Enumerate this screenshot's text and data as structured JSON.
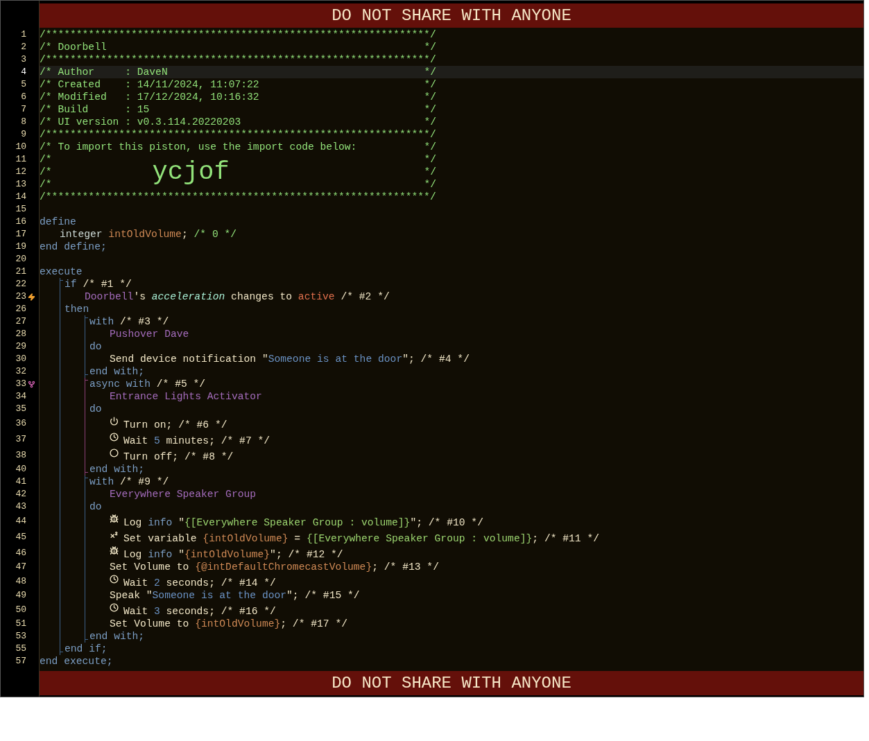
{
  "header_banner": "DO NOT SHARE WITH ANYONE",
  "code": [
    {
      "kind": "line",
      "n": "1",
      "selected": false,
      "tokens": [
        {
          "kind": "comment",
          "text": "/***************************************************************/"
        }
      ]
    },
    {
      "kind": "line",
      "n": "2",
      "selected": false,
      "tokens": [
        {
          "kind": "comment",
          "text": "/* Doorbell"
        },
        {
          "kind": "comment-end",
          "text": "*/"
        }
      ]
    },
    {
      "kind": "line",
      "n": "3",
      "selected": false,
      "tokens": [
        {
          "kind": "comment",
          "text": "/***************************************************************/"
        }
      ]
    },
    {
      "kind": "line",
      "n": "4",
      "selected": true,
      "tokens": [
        {
          "kind": "comment",
          "text": "/* Author     : DaveN"
        },
        {
          "kind": "comment-end",
          "text": "*/"
        }
      ]
    },
    {
      "kind": "line",
      "n": "5",
      "selected": false,
      "tokens": [
        {
          "kind": "comment",
          "text": "/* Created    : 14/11/2024, 11:07:22"
        },
        {
          "kind": "comment-end",
          "text": "*/"
        }
      ]
    },
    {
      "kind": "line",
      "n": "6",
      "selected": false,
      "tokens": [
        {
          "kind": "comment",
          "text": "/* Modified   : 17/12/2024, 10:16:32"
        },
        {
          "kind": "comment-end",
          "text": "*/"
        }
      ]
    },
    {
      "kind": "line",
      "n": "7",
      "selected": false,
      "tokens": [
        {
          "kind": "comment",
          "text": "/* Build      : 15"
        },
        {
          "kind": "comment-end",
          "text": "*/"
        }
      ]
    },
    {
      "kind": "line",
      "n": "8",
      "selected": false,
      "tokens": [
        {
          "kind": "comment",
          "text": "/* UI version : v0.3.114.20220203"
        },
        {
          "kind": "comment-end",
          "text": "*/"
        }
      ]
    },
    {
      "kind": "line",
      "n": "9",
      "selected": false,
      "tokens": [
        {
          "kind": "comment",
          "text": "/***************************************************************/"
        }
      ]
    },
    {
      "kind": "line",
      "n": "10",
      "selected": false,
      "tokens": [
        {
          "kind": "comment",
          "text": "/* To import this piston, use the import code below:"
        },
        {
          "kind": "comment-end",
          "text": "*/"
        }
      ]
    },
    {
      "kind": "line",
      "n": "11",
      "selected": false,
      "tokens": [
        {
          "kind": "comment",
          "text": "/*"
        },
        {
          "kind": "comment-end",
          "text": "*/"
        }
      ]
    },
    {
      "kind": "line",
      "n": "12",
      "selected": false,
      "tokens": [
        {
          "kind": "comment",
          "text": "/*"
        },
        {
          "kind": "big",
          "text": "ycjof"
        },
        {
          "kind": "comment-end",
          "text": "*/"
        }
      ]
    },
    {
      "kind": "line",
      "n": "13",
      "selected": false,
      "tokens": [
        {
          "kind": "comment",
          "text": "/*"
        },
        {
          "kind": "comment-end",
          "text": "*/"
        }
      ]
    },
    {
      "kind": "line",
      "n": "14",
      "selected": false,
      "tokens": [
        {
          "kind": "comment",
          "text": "/***************************************************************/"
        }
      ]
    },
    {
      "kind": "line",
      "n": "15",
      "selected": false
    },
    {
      "kind": "line",
      "n": "16",
      "selected": false,
      "tokens": [
        {
          "kind": "keyword",
          "text": "define"
        }
      ],
      "children": [
        {
          "kind": "line",
          "n": "17",
          "selected": false,
          "tokens": [
            {
              "kind": "type",
              "text": "integer"
            },
            {
              "kind": "variable",
              "text": "intOldVolume"
            },
            {
              "kind": "plain",
              "text": "; "
            },
            {
              "kind": "comment",
              "text": "/* 0 */"
            }
          ]
        }
      ]
    },
    {
      "kind": "line",
      "n": "19",
      "selected": false,
      "tokens": [
        {
          "kind": "keyword",
          "text": "end define;"
        }
      ]
    },
    {
      "kind": "line",
      "n": "20",
      "selected": false
    },
    {
      "kind": "line",
      "n": "21",
      "selected": false,
      "tokens": [
        {
          "kind": "keyword",
          "text": "execute"
        }
      ],
      "children": [
        {
          "kind": "block",
          "color": "#3d6189",
          "children": [
            {
              "kind": "line",
              "n": "22",
              "selected": false,
              "tokens": [
                {
                  "kind": "keyword",
                  "text": "if"
                },
                {
                  "kind": "plain",
                  "text": " /* #1 */"
                }
              ],
              "children": [
                {
                  "kind": "trigger-line",
                  "n": "23",
                  "selected": false,
                  "tokens": [
                    {
                      "kind": "device",
                      "text": "Doorbell"
                    },
                    {
                      "kind": "plain",
                      "text": "'s "
                    },
                    {
                      "kind": "attribute",
                      "text": "acceleration"
                    },
                    {
                      "kind": "plain",
                      "text": " changes to "
                    },
                    {
                      "kind": "value",
                      "text": "active"
                    },
                    {
                      "kind": "plain",
                      "text": " /* #2 */"
                    }
                  ]
                }
              ]
            },
            {
              "kind": "line",
              "n": "26",
              "selected": false,
              "tokens": [
                {
                  "kind": "keyword",
                  "text": "then"
                }
              ],
              "children": [
                {
                  "kind": "block",
                  "color": "#3d6189",
                  "children": [
                    {
                      "kind": "line",
                      "n": "27",
                      "selected": false,
                      "tokens": [
                        {
                          "kind": "keyword",
                          "text": "with"
                        },
                        {
                          "kind": "plain",
                          "text": " /* #3 */"
                        }
                      ],
                      "children": [
                        {
                          "kind": "line",
                          "n": "28",
                          "selected": false,
                          "tokens": [
                            {
                              "kind": "device",
                              "text": "Pushover Dave"
                            }
                          ]
                        }
                      ]
                    },
                    {
                      "kind": "line",
                      "n": "29",
                      "selected": false,
                      "tokens": [
                        {
                          "kind": "keyword",
                          "text": "do"
                        }
                      ],
                      "children": [
                        {
                          "kind": "line",
                          "n": "30",
                          "selected": false,
                          "tokens": [
                            {
                              "kind": "plain",
                              "text": "Send device notification \""
                            },
                            {
                              "kind": "string",
                              "text": "Someone is at the door"
                            },
                            {
                              "kind": "plain",
                              "text": "\"; /* #4 */"
                            }
                          ]
                        }
                      ]
                    },
                    {
                      "kind": "line",
                      "n": "32",
                      "selected": false,
                      "tokens": [
                        {
                          "kind": "keyword",
                          "text": "end with;"
                        }
                      ]
                    }
                  ]
                },
                {
                  "kind": "block",
                  "color": "#8c3f78",
                  "children": [
                    {
                      "kind": "async-line",
                      "n": "33",
                      "selected": false,
                      "tokens": [
                        {
                          "kind": "keyword",
                          "text": "async with"
                        },
                        {
                          "kind": "plain",
                          "text": " /* #5 */"
                        }
                      ],
                      "children": [
                        {
                          "kind": "line",
                          "n": "34",
                          "selected": false,
                          "tokens": [
                            {
                              "kind": "device",
                              "text": "Entrance Lights Activator"
                            }
                          ]
                        }
                      ]
                    },
                    {
                      "kind": "line",
                      "n": "35",
                      "selected": false,
                      "tokens": [
                        {
                          "kind": "keyword",
                          "text": "do"
                        }
                      ],
                      "children": [
                        {
                          "kind": "switch-on-line",
                          "n": "36",
                          "selected": false,
                          "tokens": [
                            {
                              "kind": "plain",
                              "text": "Turn on; /* #6 */"
                            }
                          ]
                        },
                        {
                          "kind": "wait-line",
                          "n": "37",
                          "selected": false,
                          "tokens": [
                            {
                              "kind": "plain",
                              "text": "Wait "
                            },
                            {
                              "kind": "number",
                              "text": "5"
                            },
                            {
                              "kind": "plain",
                              "text": " minutes; /* #7 */"
                            }
                          ]
                        },
                        {
                          "kind": "switch-off-line",
                          "n": "38",
                          "selected": false,
                          "tokens": [
                            {
                              "kind": "plain",
                              "text": "Turn off; /* #8 */"
                            }
                          ]
                        }
                      ]
                    },
                    {
                      "kind": "line",
                      "n": "40",
                      "selected": false,
                      "tokens": [
                        {
                          "kind": "keyword",
                          "text": "end with;"
                        }
                      ]
                    }
                  ]
                },
                {
                  "kind": "block",
                  "color": "#3d6189",
                  "children": [
                    {
                      "kind": "line",
                      "n": "41",
                      "selected": false,
                      "tokens": [
                        {
                          "kind": "keyword",
                          "text": "with"
                        },
                        {
                          "kind": "plain",
                          "text": " /* #9 */"
                        }
                      ],
                      "children": [
                        {
                          "kind": "line",
                          "n": "42",
                          "selected": false,
                          "tokens": [
                            {
                              "kind": "device",
                              "text": "Everywhere Speaker Group"
                            }
                          ]
                        }
                      ]
                    },
                    {
                      "kind": "line",
                      "n": "43",
                      "selected": false,
                      "tokens": [
                        {
                          "kind": "keyword",
                          "text": "do"
                        }
                      ],
                      "children": [
                        {
                          "kind": "log-line",
                          "n": "44",
                          "selected": false,
                          "tokens": [
                            {
                              "kind": "plain",
                              "text": "Log "
                            },
                            {
                              "kind": "keyword",
                              "text": "info"
                            },
                            {
                              "kind": "plain",
                              "text": " \""
                            },
                            {
                              "kind": "expression",
                              "text": "{[Everywhere Speaker Group : volume]}"
                            },
                            {
                              "kind": "plain",
                              "text": "\"; /* #10 */"
                            }
                          ]
                        },
                        {
                          "kind": "set-variable-line",
                          "n": "45",
                          "selected": false,
                          "tokens": [
                            {
                              "kind": "plain",
                              "text": "Set variable "
                            },
                            {
                              "kind": "variable",
                              "text": "{intOldVolume}"
                            },
                            {
                              "kind": "plain",
                              "text": " = "
                            },
                            {
                              "kind": "expression",
                              "text": "{[Everywhere Speaker Group : volume]}"
                            },
                            {
                              "kind": "plain",
                              "text": "; /* #11 */"
                            }
                          ]
                        },
                        {
                          "kind": "log-line",
                          "n": "46",
                          "selected": false,
                          "tokens": [
                            {
                              "kind": "plain",
                              "text": "Log "
                            },
                            {
                              "kind": "keyword",
                              "text": "info"
                            },
                            {
                              "kind": "plain",
                              "text": " \""
                            },
                            {
                              "kind": "variable",
                              "text": "{intOldVolume}"
                            },
                            {
                              "kind": "plain",
                              "text": "\"; /* #12 */"
                            }
                          ]
                        },
                        {
                          "kind": "line",
                          "n": "47",
                          "selected": false,
                          "tokens": [
                            {
                              "kind": "plain",
                              "text": "Set Volume to "
                            },
                            {
                              "kind": "variable",
                              "text": "{@intDefaultChromecastVolume}"
                            },
                            {
                              "kind": "plain",
                              "text": "; /* #13 */"
                            }
                          ]
                        },
                        {
                          "kind": "wait-line",
                          "n": "48",
                          "selected": false,
                          "tokens": [
                            {
                              "kind": "plain",
                              "text": "Wait "
                            },
                            {
                              "kind": "number",
                              "text": "2"
                            },
                            {
                              "kind": "plain",
                              "text": " seconds; /* #14 */"
                            }
                          ]
                        },
                        {
                          "kind": "line",
                          "n": "49",
                          "selected": false,
                          "tokens": [
                            {
                              "kind": "plain",
                              "text": "Speak \""
                            },
                            {
                              "kind": "string",
                              "text": "Someone is at the door"
                            },
                            {
                              "kind": "plain",
                              "text": "\"; /* #15 */"
                            }
                          ]
                        },
                        {
                          "kind": "wait-line",
                          "n": "50",
                          "selected": false,
                          "tokens": [
                            {
                              "kind": "plain",
                              "text": "Wait "
                            },
                            {
                              "kind": "number",
                              "text": "3"
                            },
                            {
                              "kind": "plain",
                              "text": " seconds; /* #16 */"
                            }
                          ]
                        },
                        {
                          "kind": "line",
                          "n": "51",
                          "selected": false,
                          "tokens": [
                            {
                              "kind": "plain",
                              "text": "Set Volume to "
                            },
                            {
                              "kind": "variable",
                              "text": "{intOldVolume}"
                            },
                            {
                              "kind": "plain",
                              "text": "; /* #17 */"
                            }
                          ]
                        }
                      ]
                    },
                    {
                      "kind": "line",
                      "n": "53",
                      "selected": false,
                      "tokens": [
                        {
                          "kind": "keyword",
                          "text": "end with;"
                        }
                      ]
                    }
                  ]
                }
              ]
            },
            {
              "kind": "line",
              "n": "55",
              "selected": false,
              "tokens": [
                {
                  "kind": "keyword",
                  "text": "end if;"
                }
              ]
            }
          ]
        }
      ]
    },
    {
      "kind": "line",
      "n": "57",
      "selected": false,
      "tokens": [
        {
          "kind": "keyword",
          "text": "end execute;"
        }
      ]
    }
  ],
  "footer_banner": "DO NOT SHARE WITH ANYONE"
}
